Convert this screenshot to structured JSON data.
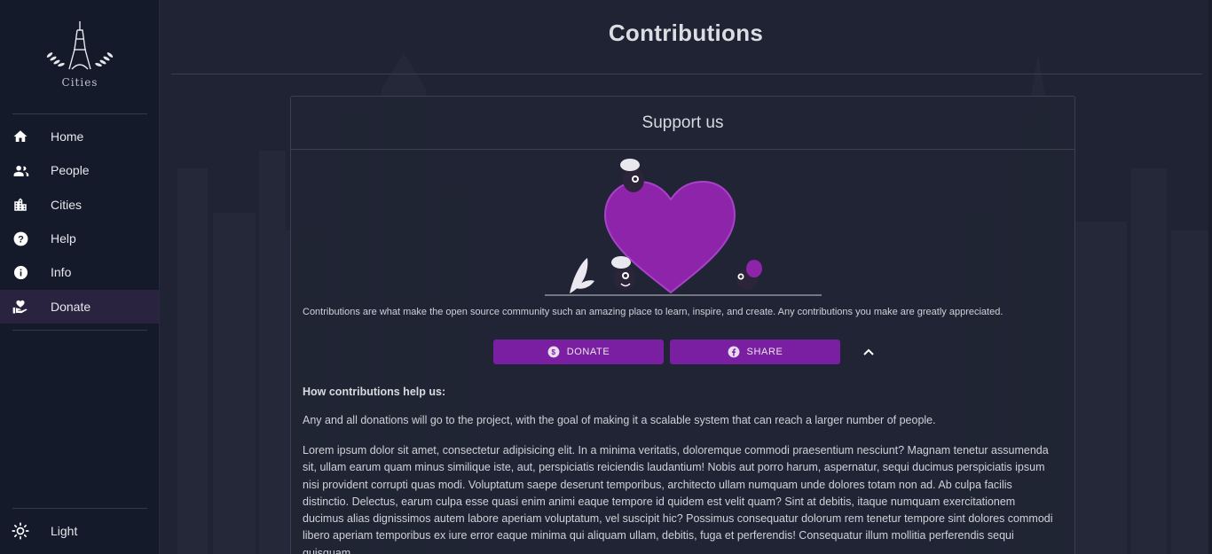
{
  "app": {
    "logo_text": "Cities"
  },
  "sidebar": {
    "items": [
      {
        "label": "Home",
        "icon": "home-icon"
      },
      {
        "label": "People",
        "icon": "people-icon"
      },
      {
        "label": "Cities",
        "icon": "city-icon"
      },
      {
        "label": "Help",
        "icon": "help-icon"
      },
      {
        "label": "Info",
        "icon": "info-icon"
      },
      {
        "label": "Donate",
        "icon": "donate-icon",
        "active": true
      }
    ],
    "theme_toggle": {
      "label": "Light",
      "icon": "sun-icon"
    }
  },
  "page": {
    "title": "Contributions"
  },
  "card": {
    "title": "Support us",
    "intro": "Contributions are what make the open source community such an amazing place to learn, inspire, and create. Any contributions you make are greatly appreciated.",
    "donate_label": "DONATE",
    "share_label": "SHARE",
    "help_title": "How contributions help us:",
    "paragraph1": "Any and all donations will go to the project, with the goal of making it a scalable system that can reach a larger number of people.",
    "paragraph2": "Lorem ipsum dolor sit amet, consectetur adipisicing elit. In a minima veritatis, doloremque commodi praesentium nesciunt? Magnam tenetur assumenda sit, ullam earum quam minus similique iste, aut, perspiciatis reiciendis laudantium! Nobis aut porro harum, aspernatur, sequi ducimus perspiciatis ipsum nisi provident corrupti quas modi. Voluptatum saepe deserunt temporibus, architecto ullam numquam unde dolores totam non ad. Ab culpa facilis distinctio. Delectus, earum culpa esse quasi enim animi eaque tempore id quidem est velit quam? Sint at debitis, itaque numquam exercitationem ducimus alias dignissimos autem labore aperiam voluptatum, vel suscipit hic? Possimus consequatur dolorum rem tenetur tempore sint dolores commodi libero aperiam temporibus ex iure error eaque minima qui aliquam ullam, debitis, fuga et perferendis! Consequatur illum mollitia perferendis sequi quisquam."
  },
  "colors": {
    "accent": "#7b1fa2",
    "sidebar_bg": "#151a2b",
    "main_bg": "#1f2333",
    "active_item_bg": "#2a2340"
  }
}
